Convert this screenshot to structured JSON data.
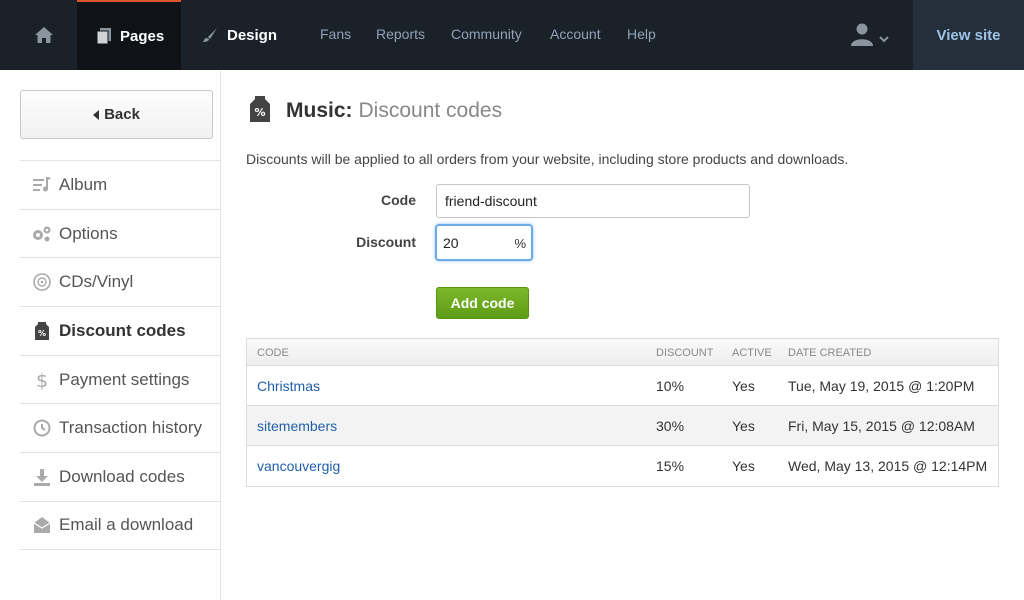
{
  "nav": {
    "pages_label": "Pages",
    "design_label": "Design",
    "links": [
      "Fans",
      "Reports",
      "Community",
      "Account",
      "Help"
    ],
    "view_site_label": "View site"
  },
  "sidebar": {
    "back_label": "Back",
    "items": [
      {
        "label": "Album",
        "icon": "album-icon"
      },
      {
        "label": "Options",
        "icon": "gears-icon"
      },
      {
        "label": "CDs/Vinyl",
        "icon": "disc-icon"
      },
      {
        "label": "Discount codes",
        "icon": "discount-tag-icon",
        "active": true
      },
      {
        "label": "Payment settings",
        "icon": "dollar-icon"
      },
      {
        "label": "Transaction history",
        "icon": "history-icon"
      },
      {
        "label": "Download codes",
        "icon": "download-icon"
      },
      {
        "label": "Email a download",
        "icon": "email-icon"
      }
    ]
  },
  "main": {
    "title_section": "Music:",
    "title_page": "Discount codes",
    "intro": "Discounts will be applied to all orders from your website, including store products and downloads.",
    "form": {
      "code_label": "Code",
      "code_value": "friend-discount",
      "discount_label": "Discount",
      "discount_value": "20",
      "discount_suffix": "%",
      "add_label": "Add code"
    },
    "table": {
      "headers": [
        "CODE",
        "DISCOUNT",
        "ACTIVE",
        "DATE CREATED"
      ],
      "rows": [
        {
          "code": "Christmas",
          "discount": "10%",
          "active": "Yes",
          "date": "Tue, May 19, 2015 @ 1:20PM"
        },
        {
          "code": "sitemembers",
          "discount": "30%",
          "active": "Yes",
          "date": "Fri, May 15, 2015 @ 12:08AM"
        },
        {
          "code": "vancouvergig",
          "discount": "15%",
          "active": "Yes",
          "date": "Wed, May 13, 2015 @ 12:14PM"
        }
      ]
    }
  },
  "colors": {
    "topbar": "#1b2129",
    "active_tab_accent": "#d9532c",
    "link_blue": "#1f5fa8",
    "add_button_green": "#6aa81f",
    "view_site_text": "#9fc3e6"
  }
}
